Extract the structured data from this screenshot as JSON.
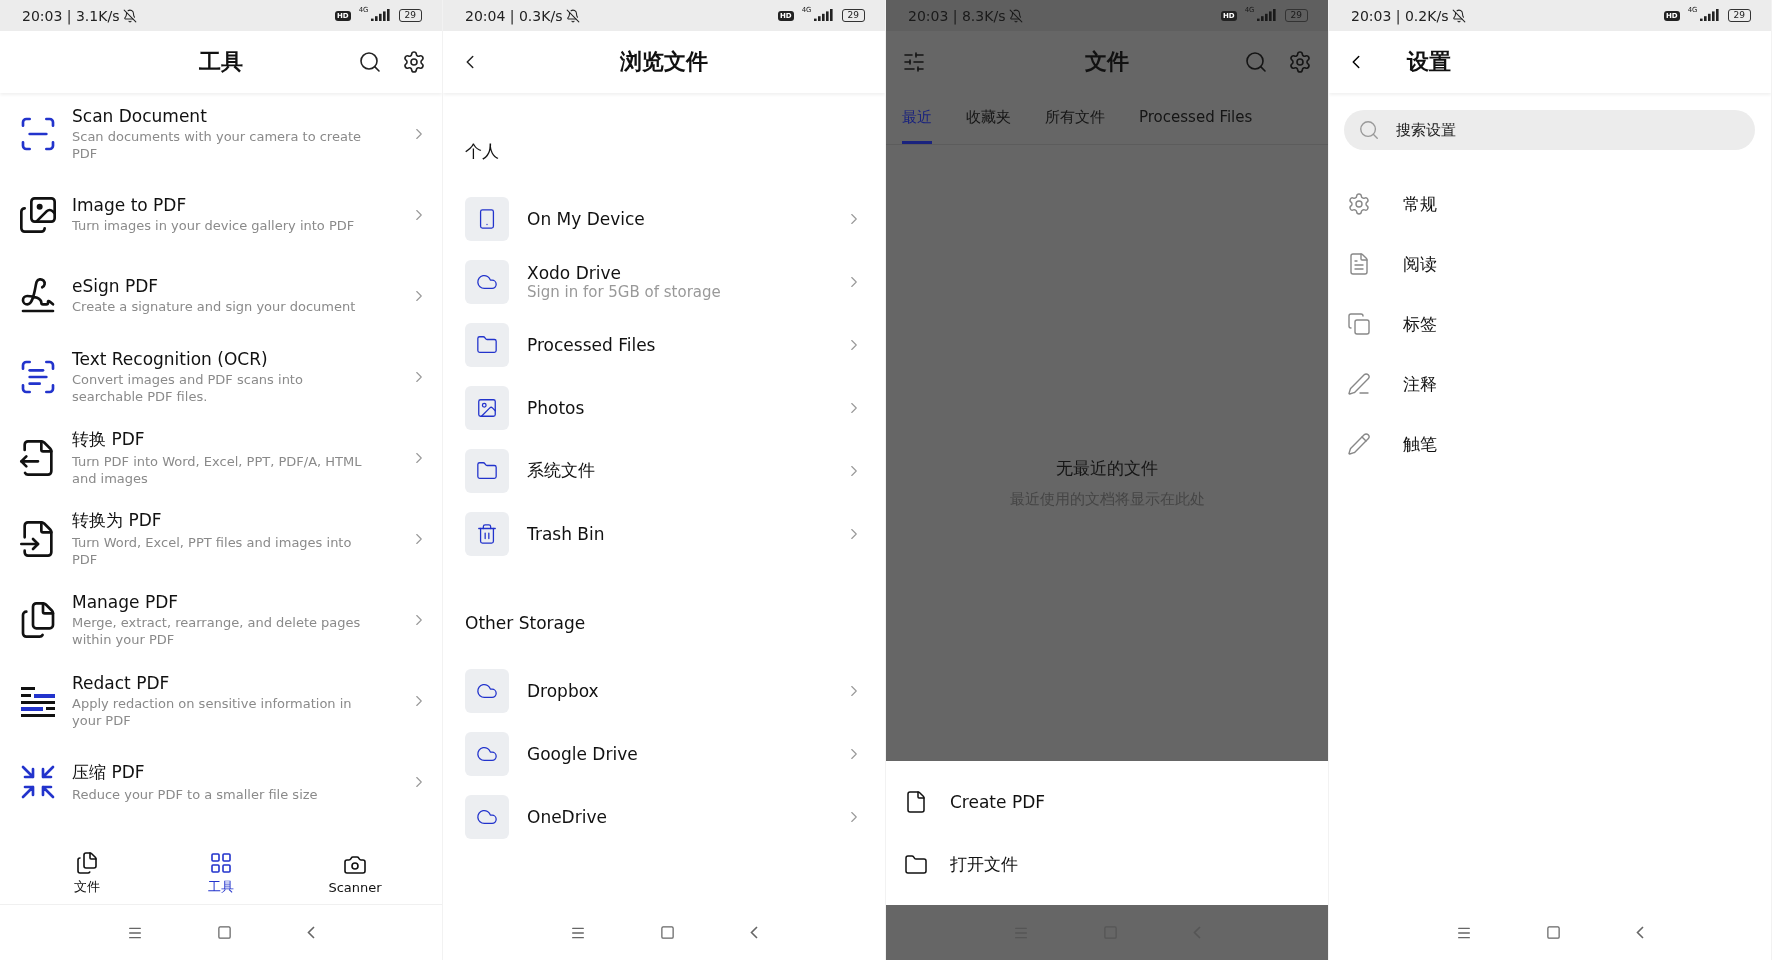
{
  "tools_screen": {
    "status_bar": {
      "time_speed": "20:03 | 3.1K/s",
      "hd": "HD",
      "network": "4G",
      "battery": "29"
    },
    "title": "工具",
    "tools": [
      {
        "kind": "scan",
        "title": "Scan Document",
        "description": "Scan documents with your camera to create PDF"
      },
      {
        "kind": "image",
        "title": "Image to PDF",
        "description": "Turn images in your device gallery into PDF"
      },
      {
        "kind": "sign",
        "title": "eSign PDF",
        "description": "Create a signature and sign your document"
      },
      {
        "kind": "ocr",
        "title": "Text Recognition (OCR)",
        "description": "Convert images and PDF scans into searchable PDF files."
      },
      {
        "kind": "export",
        "title": "转换 PDF",
        "description": "Turn PDF into Word, Excel, PPT, PDF/A, HTML and images"
      },
      {
        "kind": "import",
        "title": "转换为 PDF",
        "description": "Turn Word, Excel, PPT files and images into PDF"
      },
      {
        "kind": "manage",
        "title": "Manage PDF",
        "description": "Merge, extract, rearrange, and delete pages within your PDF"
      },
      {
        "kind": "redact",
        "title": "Redact PDF",
        "description": "Apply redaction on sensitive information in your PDF"
      },
      {
        "kind": "compress",
        "title": "压缩 PDF",
        "description": "Reduce your PDF to a smaller file size"
      }
    ],
    "bottom_tabs": [
      {
        "kind": "files",
        "label": "文件",
        "selected": false
      },
      {
        "kind": "tools",
        "label": "工具",
        "selected": true
      },
      {
        "kind": "camera",
        "label": "Scanner",
        "selected": false
      }
    ]
  },
  "browse_screen": {
    "status_bar": {
      "time_speed": "20:04 | 0.3K/s",
      "hd": "HD",
      "network": "4G",
      "battery": "29"
    },
    "title": "浏览文件",
    "sections": [
      {
        "heading": "个人",
        "items": [
          {
            "kind": "device",
            "label": "On My Device"
          },
          {
            "kind": "cloud",
            "label": "Xodo Drive",
            "subtitle": "Sign in for 5GB of storage"
          },
          {
            "kind": "folder",
            "label": "Processed Files"
          },
          {
            "kind": "photos",
            "label": "Photos"
          },
          {
            "kind": "folder",
            "label": "系统文件"
          },
          {
            "kind": "trash",
            "label": "Trash Bin"
          }
        ]
      },
      {
        "heading": "Other Storage",
        "items": [
          {
            "kind": "cloud",
            "label": "Dropbox"
          },
          {
            "kind": "cloud",
            "label": "Google Drive"
          },
          {
            "kind": "cloud",
            "label": "OneDrive"
          }
        ]
      }
    ]
  },
  "files_screen": {
    "status_bar": {
      "time_speed": "20:03 | 8.3K/s",
      "hd": "HD",
      "network": "4G",
      "battery": "29"
    },
    "dimmed": true,
    "title": "文件",
    "tabs": [
      {
        "label": "最近",
        "selected": true
      },
      {
        "label": "收藏夹",
        "selected": false
      },
      {
        "label": "所有文件",
        "selected": false
      },
      {
        "label": "Processed Files",
        "selected": false
      }
    ],
    "empty_title": "无最近的文件",
    "empty_message": "最近使用的文档将显示在此处",
    "sheet_items": [
      {
        "kind": "file",
        "label": "Create PDF"
      },
      {
        "kind": "folder",
        "label": "打开文件"
      }
    ]
  },
  "settings_screen": {
    "status_bar": {
      "time_speed": "20:03 | 0.2K/s",
      "hd": "HD",
      "network": "4G",
      "battery": "29"
    },
    "title": "设置",
    "search": {
      "placeholder": "搜索设置"
    },
    "items": [
      {
        "kind": "general",
        "label": "常规"
      },
      {
        "kind": "reading",
        "label": "阅读"
      },
      {
        "kind": "tabs",
        "label": "标签"
      },
      {
        "kind": "annotation",
        "label": "注释"
      },
      {
        "kind": "stylus",
        "label": "触笔"
      }
    ]
  }
}
